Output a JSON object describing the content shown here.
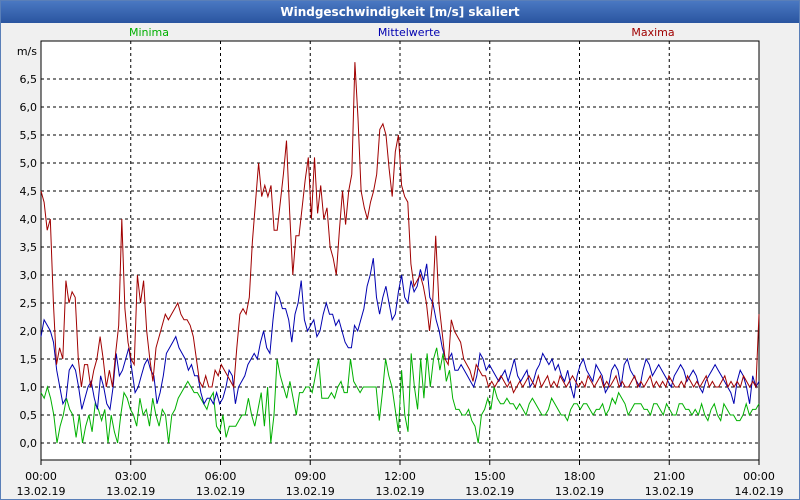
{
  "window": {
    "title": "Windgeschwindigkeit [m/s] skaliert"
  },
  "chart_data": {
    "type": "line",
    "title": "Windgeschwindigkeit [m/s] skaliert",
    "ylabel": "m/s",
    "ylim": [
      -0.3,
      7.3
    ],
    "yticks": [
      "0,0",
      "0,5",
      "1,0",
      "1,5",
      "2,0",
      "2,5",
      "3,0",
      "3,5",
      "4,0",
      "4,5",
      "5,0",
      "5,5",
      "6,0",
      "6,5"
    ],
    "xticks": [
      {
        "time": "00:00",
        "date": "13.02.19"
      },
      {
        "time": "03:00",
        "date": "13.02.19"
      },
      {
        "time": "06:00",
        "date": "13.02.19"
      },
      {
        "time": "09:00",
        "date": "13.02.19"
      },
      {
        "time": "12:00",
        "date": "13.02.19"
      },
      {
        "time": "15:00",
        "date": "13.02.19"
      },
      {
        "time": "18:00",
        "date": "13.02.19"
      },
      {
        "time": "21:00",
        "date": "13.02.19"
      },
      {
        "time": "00:00",
        "date": "14.02.19"
      }
    ],
    "x_interval": "10 min",
    "grid": true,
    "legend_position": "top",
    "series": [
      {
        "name": "Minima",
        "color": "#00b000",
        "values": [
          0.9,
          0.8,
          1.0,
          0.8,
          0.5,
          0.0,
          0.3,
          0.5,
          0.8,
          0.6,
          0.5,
          0.1,
          0.5,
          0.0,
          0.3,
          0.5,
          0.2,
          0.7,
          0.6,
          0.4,
          0.6,
          0.0,
          0.5,
          0.2,
          0.0,
          0.5,
          0.9,
          0.8,
          0.6,
          0.5,
          0.3,
          0.8,
          0.5,
          0.6,
          0.3,
          0.8,
          0.5,
          0.3,
          0.6,
          0.5,
          0.0,
          0.5,
          0.6,
          0.8,
          0.9,
          1.0,
          1.1,
          1.0,
          0.9,
          0.9,
          0.8,
          0.7,
          0.6,
          0.8,
          0.9,
          0.3,
          0.2,
          0.5,
          0.1,
          0.3,
          0.3,
          0.3,
          0.4,
          0.5,
          0.5,
          0.8,
          0.5,
          0.3,
          0.6,
          0.9,
          0.3,
          1.0,
          0.0,
          0.5,
          1.5,
          1.2,
          1.0,
          0.8,
          1.1,
          0.8,
          0.5,
          0.9,
          0.9,
          1.0,
          1.0,
          0.9,
          1.2,
          1.5,
          0.8,
          0.8,
          0.8,
          0.9,
          0.8,
          1.0,
          1.1,
          0.9,
          0.9,
          1.5,
          1.1,
          1.0,
          0.9,
          1.0,
          1.0,
          1.0,
          1.0,
          1.0,
          0.4,
          0.9,
          1.5,
          1.2,
          1.0,
          0.6,
          0.2,
          1.3,
          0.5,
          0.2,
          1.6,
          1.0,
          0.6,
          1.5,
          0.8,
          1.6,
          1.0,
          1.5,
          1.7,
          1.3,
          1.6,
          1.1,
          1.3,
          0.8,
          0.6,
          0.6,
          0.5,
          0.5,
          0.6,
          0.4,
          0.3,
          0.0,
          0.5,
          0.6,
          0.8,
          0.6,
          1.0,
          0.8,
          0.7,
          0.7,
          0.8,
          0.7,
          0.7,
          0.6,
          0.7,
          0.6,
          0.5,
          0.7,
          0.8,
          0.7,
          0.6,
          0.5,
          0.5,
          0.6,
          0.8,
          0.7,
          0.6,
          0.5,
          0.5,
          0.4,
          0.6,
          0.7,
          0.7,
          0.6,
          0.7,
          0.7,
          0.6,
          0.5,
          0.6,
          0.6,
          0.7,
          0.5,
          0.6,
          0.8,
          0.7,
          0.9,
          0.8,
          0.7,
          0.5,
          0.6,
          0.7,
          0.7,
          0.7,
          0.6,
          0.6,
          0.5,
          0.7,
          0.7,
          0.6,
          0.5,
          0.7,
          0.6,
          0.5,
          0.5,
          0.7,
          0.7,
          0.6,
          0.6,
          0.5,
          0.6,
          0.5,
          0.7,
          0.5,
          0.4,
          0.6,
          0.7,
          0.5,
          0.4,
          0.7,
          0.6,
          0.5,
          0.5,
          0.4,
          0.4,
          0.5,
          0.7,
          0.5,
          0.6,
          0.6,
          0.7
        ]
      },
      {
        "name": "Mittelwerte",
        "color": "#0000b0",
        "values": [
          1.9,
          2.2,
          2.1,
          2.0,
          1.8,
          1.3,
          1.0,
          0.7,
          0.8,
          1.3,
          1.4,
          1.3,
          1.0,
          0.6,
          0.8,
          1.0,
          1.1,
          0.8,
          0.6,
          1.2,
          1.0,
          0.7,
          0.6,
          1.0,
          1.6,
          1.2,
          1.3,
          1.5,
          1.7,
          1.3,
          0.9,
          1.0,
          1.2,
          1.4,
          1.5,
          1.3,
          1.2,
          0.7,
          0.9,
          1.2,
          1.6,
          1.7,
          1.8,
          1.9,
          1.7,
          1.6,
          1.5,
          1.3,
          1.4,
          1.2,
          1.2,
          0.9,
          0.7,
          0.8,
          0.8,
          0.7,
          0.9,
          0.7,
          0.8,
          1.0,
          1.3,
          1.2,
          0.7,
          1.0,
          1.1,
          1.2,
          1.4,
          1.5,
          1.6,
          1.5,
          1.8,
          2.0,
          1.7,
          1.6,
          2.2,
          2.7,
          2.6,
          2.4,
          2.4,
          2.2,
          1.8,
          2.3,
          2.5,
          2.9,
          2.2,
          2.0,
          2.1,
          2.2,
          1.9,
          2.0,
          2.3,
          2.5,
          2.3,
          2.3,
          2.1,
          2.2,
          2.0,
          1.8,
          1.7,
          1.7,
          2.1,
          2.0,
          2.2,
          2.4,
          2.8,
          3.0,
          3.3,
          2.6,
          2.3,
          2.6,
          2.8,
          2.5,
          2.2,
          2.3,
          2.7,
          3.0,
          2.6,
          2.5,
          2.9,
          2.7,
          2.8,
          3.1,
          2.9,
          3.2,
          2.6,
          2.5,
          2.2,
          2.0,
          1.7,
          1.5,
          1.5,
          1.6,
          1.3,
          1.3,
          1.4,
          1.3,
          1.2,
          1.1,
          1.0,
          1.2,
          1.6,
          1.5,
          1.3,
          1.4,
          1.3,
          1.2,
          1.1,
          1.2,
          1.3,
          1.1,
          1.3,
          1.5,
          1.2,
          1.1,
          1.2,
          1.3,
          1.0,
          1.1,
          1.3,
          1.4,
          1.6,
          1.5,
          1.4,
          1.5,
          1.3,
          1.4,
          1.2,
          1.1,
          1.3,
          1.0,
          0.8,
          1.2,
          1.4,
          1.5,
          1.3,
          1.2,
          1.1,
          1.4,
          1.3,
          1.2,
          0.9,
          1.0,
          1.3,
          1.4,
          1.3,
          1.0,
          1.4,
          1.5,
          1.3,
          1.2,
          1.1,
          1.0,
          1.3,
          1.5,
          1.4,
          1.2,
          1.3,
          1.4,
          1.3,
          1.2,
          1.1,
          1.0,
          1.2,
          1.3,
          1.4,
          1.3,
          1.1,
          1.2,
          1.3,
          1.2,
          1.0,
          0.9,
          1.1,
          1.2,
          1.3,
          1.4,
          1.3,
          1.2,
          1.1,
          1.0,
          0.9,
          0.7,
          1.1,
          1.3,
          1.2,
          1.0,
          0.7,
          1.2,
          1.0,
          1.1
        ]
      },
      {
        "name": "Maxima",
        "color": "#a00000",
        "values": [
          4.5,
          4.3,
          3.8,
          4.0,
          2.5,
          1.4,
          1.7,
          1.5,
          2.9,
          2.5,
          2.7,
          2.6,
          1.5,
          1.0,
          1.4,
          1.4,
          1.0,
          1.3,
          1.5,
          1.9,
          1.5,
          1.0,
          1.3,
          1.0,
          1.6,
          2.1,
          4.0,
          2.4,
          1.8,
          1.5,
          1.4,
          3.0,
          2.5,
          2.9,
          2.0,
          1.5,
          1.1,
          1.7,
          1.9,
          2.1,
          2.3,
          2.2,
          2.3,
          2.4,
          2.5,
          2.3,
          2.2,
          2.2,
          2.1,
          1.9,
          1.5,
          1.1,
          1.0,
          1.2,
          1.0,
          1.0,
          1.3,
          1.2,
          1.4,
          1.3,
          1.2,
          1.1,
          1.0,
          1.7,
          2.3,
          2.4,
          2.3,
          2.6,
          3.6,
          4.3,
          5.0,
          4.4,
          4.6,
          4.4,
          4.6,
          3.8,
          3.8,
          4.3,
          4.8,
          5.4,
          4.1,
          3.0,
          3.7,
          3.7,
          4.2,
          4.7,
          5.1,
          4.0,
          5.1,
          4.1,
          4.6,
          4.0,
          4.2,
          3.5,
          3.3,
          3.0,
          3.8,
          4.5,
          3.9,
          4.5,
          4.8,
          6.8,
          5.8,
          4.5,
          4.2,
          4.0,
          4.3,
          4.5,
          4.8,
          5.6,
          5.7,
          5.5,
          4.9,
          4.4,
          5.2,
          5.5,
          4.6,
          4.4,
          4.3,
          3.2,
          2.8,
          2.9,
          3.0,
          2.8,
          2.5,
          2.0,
          2.5,
          3.7,
          2.5,
          2.0,
          1.5,
          1.4,
          2.2,
          2.0,
          1.9,
          1.8,
          1.5,
          1.4,
          1.3,
          1.1,
          1.4,
          1.3,
          1.2,
          1.2,
          1.0,
          1.1,
          1.0,
          1.1,
          1.2,
          1.1,
          1.0,
          1.1,
          0.9,
          1.0,
          1.1,
          1.0,
          1.1,
          1.2,
          1.1,
          1.0,
          1.2,
          1.0,
          1.1,
          1.2,
          1.0,
          1.1,
          1.0,
          1.2,
          1.1,
          1.0,
          1.1,
          1.2,
          1.1,
          1.0,
          1.1,
          1.0,
          1.2,
          1.1,
          1.0,
          1.1,
          1.2,
          1.0,
          1.1,
          1.0,
          1.1,
          1.2,
          1.0,
          1.1,
          1.0,
          1.0,
          1.1,
          1.2,
          1.0,
          1.1,
          1.0,
          1.1,
          1.2,
          1.0,
          1.1,
          1.0,
          1.1,
          1.0,
          1.2,
          1.1,
          1.0,
          1.0,
          1.1,
          1.0,
          1.2,
          1.1,
          1.0,
          1.1,
          1.0,
          1.1,
          1.2,
          1.0,
          1.1,
          1.0,
          1.0,
          1.1,
          1.2,
          1.0,
          1.1,
          1.0,
          1.1,
          1.0,
          1.2,
          1.1,
          1.0,
          1.1,
          1.0,
          2.3
        ]
      }
    ]
  }
}
